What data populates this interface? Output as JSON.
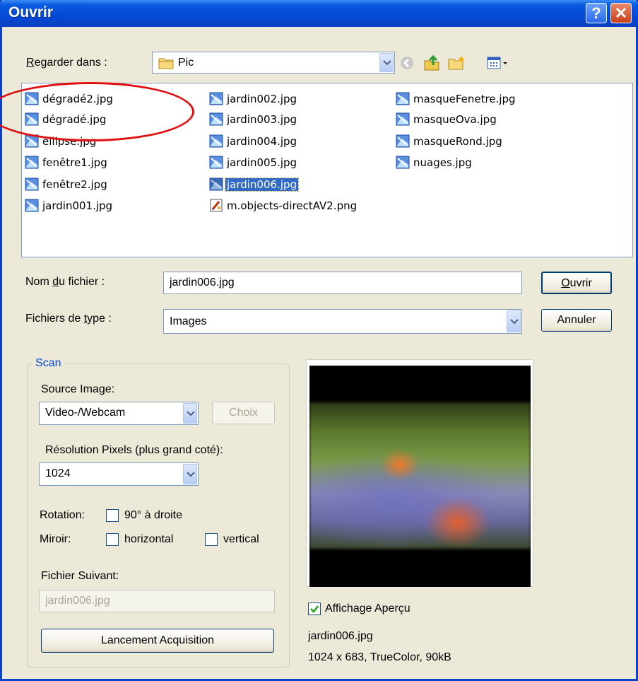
{
  "window": {
    "title": "Ouvrir",
    "help": "?",
    "close": "✕"
  },
  "lookin": {
    "label_u": "R",
    "label_rest": "egarder dans :",
    "value": "Pic"
  },
  "files": [
    {
      "name": "dégradé2.jpg",
      "type": "jpg"
    },
    {
      "name": "dégradé.jpg",
      "type": "jpg"
    },
    {
      "name": "ellipse.jpg",
      "type": "jpg"
    },
    {
      "name": "fenêtre1.jpg",
      "type": "jpg"
    },
    {
      "name": "fenêtre2.jpg",
      "type": "jpg"
    },
    {
      "name": "jardin001.jpg",
      "type": "jpg"
    },
    {
      "name": "jardin002.jpg",
      "type": "jpg"
    },
    {
      "name": "jardin003.jpg",
      "type": "jpg"
    },
    {
      "name": "jardin004.jpg",
      "type": "jpg"
    },
    {
      "name": "jardin005.jpg",
      "type": "jpg"
    },
    {
      "name": "jardin006.jpg",
      "type": "jpg",
      "selected": true
    },
    {
      "name": "m.objects-directAV2.png",
      "type": "png"
    },
    {
      "name": "masqueFenetre.jpg",
      "type": "jpg"
    },
    {
      "name": "masqueOva.jpg",
      "type": "jpg"
    },
    {
      "name": "masqueRond.jpg",
      "type": "jpg"
    },
    {
      "name": "nuages.jpg",
      "type": "jpg"
    }
  ],
  "filename": {
    "label_a": "Nom ",
    "label_u": "d",
    "label_b": "u fichier :",
    "value": "jardin006.jpg"
  },
  "filetype": {
    "label_a": "Fichiers de ",
    "label_u": "t",
    "label_b": "ype :",
    "value": "Images"
  },
  "buttons": {
    "open_u": "O",
    "open_rest": "uvrir",
    "cancel": "Annuler"
  },
  "scan": {
    "legend": "Scan",
    "source_label": "Source Image:",
    "source_value": "Video-/Webcam",
    "choix": "Choix",
    "resolution_label": "Résolution Pixels (plus grand coté):",
    "resolution_value": "1024",
    "rotation_label": "Rotation:",
    "rotation_option": "90° à droite",
    "mirror_label": "Miroir:",
    "mirror_h": "horizontal",
    "mirror_v": "vertical",
    "next_label": "Fichier Suivant:",
    "next_value": "jardin006.jpg",
    "launch": "Lancement Acquisition"
  },
  "preview": {
    "checkbox_label": "Affichage Aperçu",
    "checked": true,
    "filename": "jardin006.jpg",
    "info": "1024 x 683, TrueColor, 90kB"
  },
  "colors": {
    "titlebar": "#0349d6",
    "selection": "#316ac5",
    "annotation": "#e01010"
  }
}
